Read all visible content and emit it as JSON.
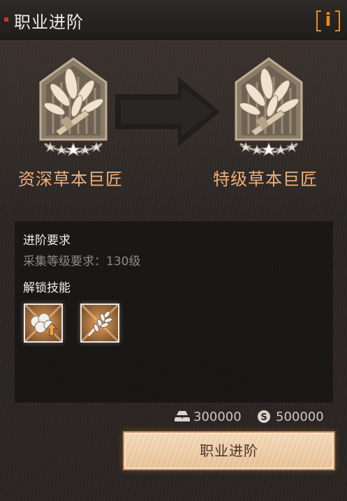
{
  "window": {
    "title": "职业进阶",
    "info_label": "i"
  },
  "ranks": {
    "from": {
      "name": "资深草本巨匠",
      "stars": 5,
      "icon": "herb-laurel-badge-icon"
    },
    "to": {
      "name": "特级草本巨匠",
      "stars": 5,
      "icon": "herb-laurel-badge-icon"
    }
  },
  "requirements": {
    "title": "进阶要求",
    "level_requirement": "采集等级要求：130级",
    "skills_title": "解锁技能",
    "skills": [
      {
        "icon": "cotton-upgrade-icon"
      },
      {
        "icon": "wheat-stalk-icon"
      }
    ]
  },
  "costs": [
    {
      "icon": "ingot-icon",
      "value": "300000"
    },
    {
      "icon": "silver-coin-icon",
      "value": "500000"
    }
  ],
  "actions": {
    "advance_label": "职业进阶"
  },
  "colors": {
    "accent_orange": "#e88a2e",
    "rank_name": "#f0b07a",
    "button_fill": "#efcfa9"
  }
}
